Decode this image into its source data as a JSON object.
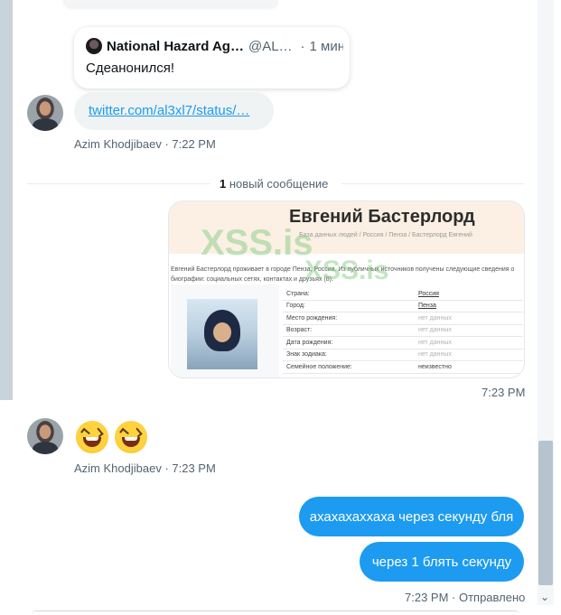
{
  "quote": {
    "name": "National Hazard Ag…",
    "handle": "@AL…",
    "dot": "·",
    "time": "1 мин",
    "text": "Сдеанонился!"
  },
  "messages": {
    "link_text": "twitter.com/al3xl7/status/…",
    "meta1": "Azim Khodjibaev · 7:22 PM",
    "divider_count": "1",
    "divider_label": " новый сообщение",
    "image_time": "7:23 PM",
    "meta2": "Azim Khodjibaev · 7:23 PM",
    "sent1": "ахахахаххаха через секунду бля",
    "sent2": "через 1 блять секунду",
    "sent_meta": "7:23 PM · Отправлено"
  },
  "image_card": {
    "title": "Евгений Бастерлорд",
    "breadcrumbs": "База данных людей  /  Россия  /  Пенза  /  Бастерлорд Евгений",
    "intro": "Евгений Бастерлорд проживает в городе Пенза, Россия. Из публичных источников получены следующие сведения о биографии: социальных сетях, контактах и друзьях (8).",
    "watermark1": "XSS.is",
    "watermark2": "XSS.is",
    "rows": [
      {
        "k": "Страна:",
        "v": "Россия"
      },
      {
        "k": "Город:",
        "v": "Пенза"
      },
      {
        "k": "Место рождения:",
        "v": "нет данных"
      },
      {
        "k": "Возраст:",
        "v": "нет данных"
      },
      {
        "k": "Дата рождения:",
        "v": "нет данных"
      },
      {
        "k": "Знак зодиака:",
        "v": "нет данных"
      },
      {
        "k": "Семейное положение:",
        "v": "неизвестно"
      }
    ]
  },
  "icons": {
    "emoji": "grinning-squinting-face",
    "scroll_down": "chevron-down-icon"
  },
  "colors": {
    "accent": "#1d9bf0",
    "bubble_bg": "#eff3f4",
    "muted_text": "#536471"
  }
}
